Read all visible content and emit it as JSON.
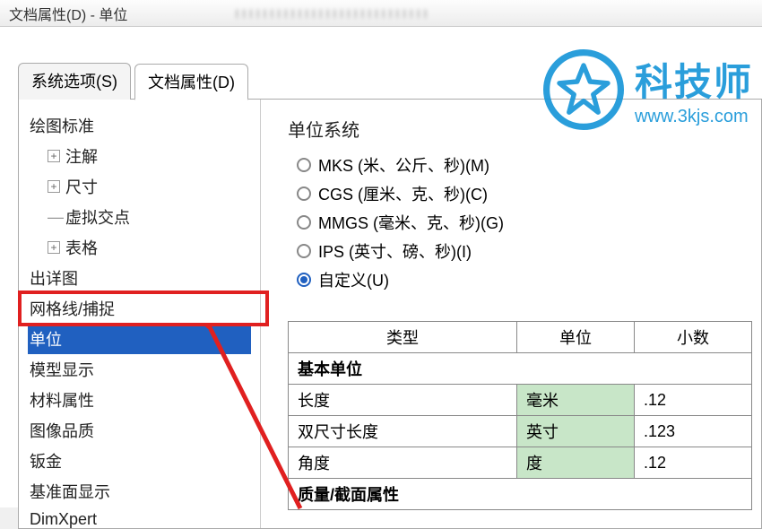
{
  "window": {
    "title": "文档属性(D) - 单位"
  },
  "tabs": {
    "system": "系统选项(S)",
    "document": "文档属性(D)"
  },
  "tree": {
    "drawing_standard": "绘图标准",
    "annotations": "注解",
    "dimensions": "尺寸",
    "virtual_sharp": "虚拟交点",
    "tables": "表格",
    "detailing": "出详图",
    "grid_snap": "网格线/捕捉",
    "units": "单位",
    "model_display": "模型显示",
    "material_props": "材料属性",
    "image_quality": "图像品质",
    "sheet_metal": "钣金",
    "plane_display": "基准面显示",
    "dimxpert": "DimXpert"
  },
  "unit_system": {
    "label": "单位系统",
    "mks": "MKS (米、公斤、秒)(M)",
    "cgs": "CGS (厘米、克、秒)(C)",
    "mmgs": "MMGS (毫米、克、秒)(G)",
    "ips": "IPS (英寸、磅、秒)(I)",
    "custom": "自定义(U)"
  },
  "table": {
    "headers": {
      "type": "类型",
      "unit": "单位",
      "decimal": "小数"
    },
    "basic_units": "基本单位",
    "length": {
      "label": "长度",
      "unit": "毫米",
      "decimal": ".12"
    },
    "dual_length": {
      "label": "双尺寸长度",
      "unit": "英寸",
      "decimal": ".123"
    },
    "angle": {
      "label": "角度",
      "unit": "度",
      "decimal": ".12"
    },
    "mass_section": "质量/截面属性"
  },
  "watermark": {
    "title": "科技师",
    "url": "www.3kjs.com"
  }
}
